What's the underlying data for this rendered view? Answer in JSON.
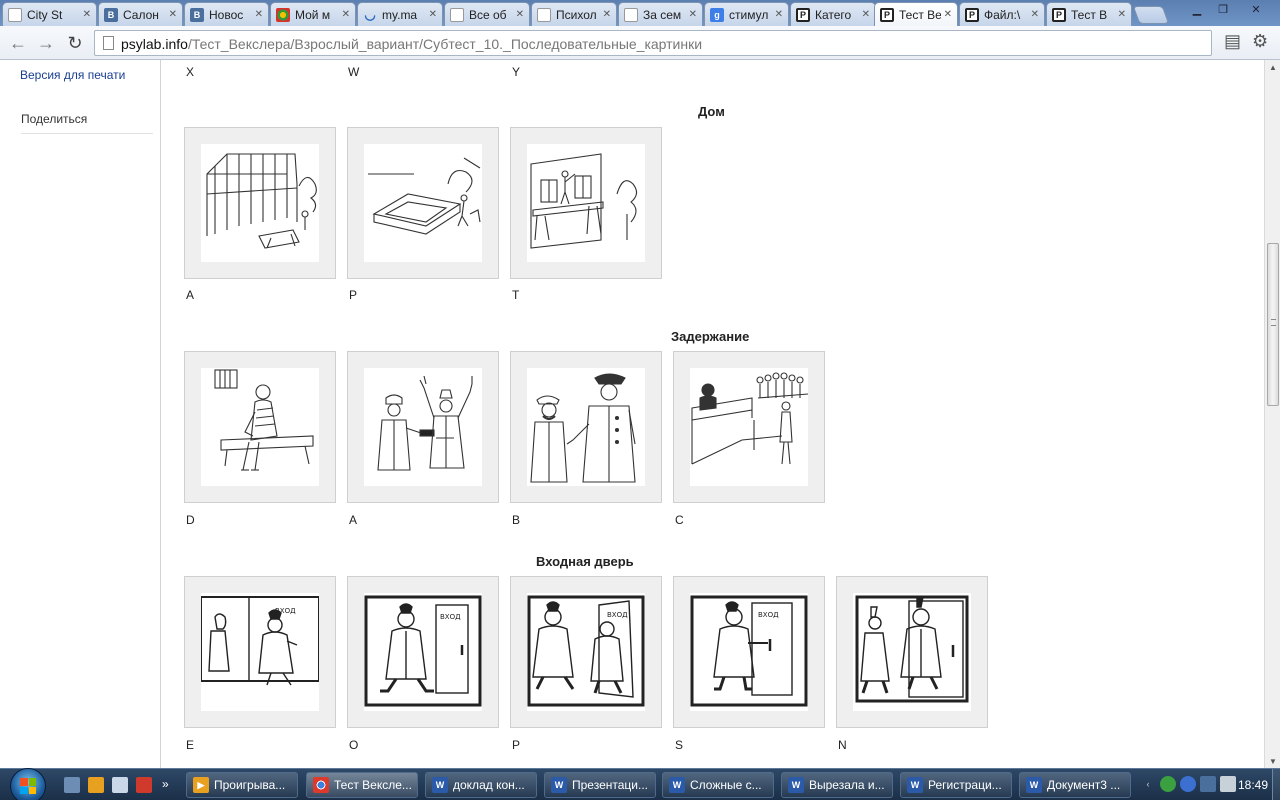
{
  "browser": {
    "tabs": [
      {
        "label": "City St",
        "favicon": "page-icon"
      },
      {
        "label": "Салон",
        "favicon": "vk-icon"
      },
      {
        "label": "Новос",
        "favicon": "vk-icon"
      },
      {
        "label": "Мой м",
        "favicon": "mailru-agent-icon"
      },
      {
        "label": "my.ma",
        "favicon": "mailru-icon"
      },
      {
        "label": "Все об",
        "favicon": "page-icon"
      },
      {
        "label": "Психол",
        "favicon": "page-icon"
      },
      {
        "label": "За сем",
        "favicon": "page-icon"
      },
      {
        "label": "стимул",
        "favicon": "google-icon"
      },
      {
        "label": "Катего",
        "favicon": "psylab-icon"
      },
      {
        "label": "Тест Ве",
        "favicon": "psylab-icon",
        "active": true
      },
      {
        "label": "Файл:\\",
        "favicon": "psylab-icon"
      },
      {
        "label": "Тест В",
        "favicon": "psylab-icon"
      }
    ],
    "url_host": "psylab.info",
    "url_path": "/Тест_Векслера/Взрослый_вариант/Субтест_10._Последовательные_картинки"
  },
  "sidebar": {
    "print_label": "Версия для печати",
    "share_label": "Поделиться"
  },
  "page": {
    "prev_labels": [
      "X",
      "W",
      "Y"
    ],
    "sections": [
      {
        "title": "Дом",
        "cards": [
          {
            "label": "A",
            "pic": "greenhouse-frame"
          },
          {
            "label": "P",
            "pic": "foundation-pit"
          },
          {
            "label": "T",
            "pic": "house-scaffold"
          }
        ]
      },
      {
        "title": "Задержание",
        "cards": [
          {
            "label": "D",
            "pic": "prisoner-bench"
          },
          {
            "label": "A",
            "pic": "robbery-hands-up"
          },
          {
            "label": "B",
            "pic": "policeman-arrest"
          },
          {
            "label": "C",
            "pic": "courtroom"
          }
        ]
      },
      {
        "title": "Входная дверь",
        "cards": [
          {
            "label": "E",
            "pic": "door-walk"
          },
          {
            "label": "O",
            "pic": "door-approach"
          },
          {
            "label": "P",
            "pic": "door-pass"
          },
          {
            "label": "S",
            "pic": "door-handle"
          },
          {
            "label": "N",
            "pic": "door-exit"
          }
        ]
      }
    ],
    "door_sign": "ВХОД"
  },
  "taskbar": {
    "tasks": [
      {
        "label": "Проигрыва...",
        "icon": "media-player-icon"
      },
      {
        "label": "Тест Вексле...",
        "icon": "chrome-icon",
        "active": true
      },
      {
        "label": "доклад кон...",
        "icon": "word-icon"
      },
      {
        "label": "Презентаци...",
        "icon": "word-icon"
      },
      {
        "label": "Сложные с...",
        "icon": "word-icon"
      },
      {
        "label": "Вырезала и...",
        "icon": "word-icon"
      },
      {
        "label": "Регистраци...",
        "icon": "word-icon"
      },
      {
        "label": "Документ3 ...",
        "icon": "word-icon"
      }
    ],
    "clock": "18:49"
  },
  "colors": {
    "link": "#1a3f8f",
    "vk": "#4a6f9c",
    "tab_strip": "#6f95c6",
    "taskbar": "#1b2f48"
  }
}
